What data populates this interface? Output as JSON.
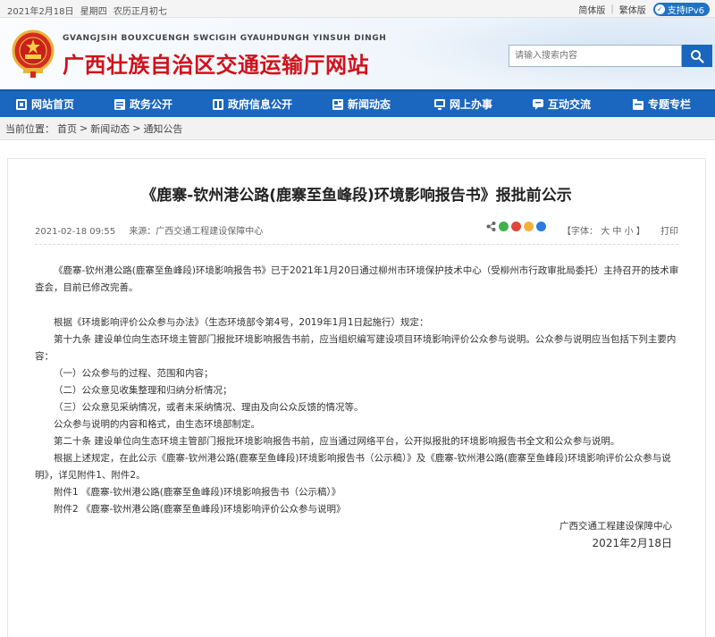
{
  "topbar": {
    "date": "2021年2月18日",
    "weekday": "星期四",
    "lunar": "农历正月初七",
    "simplified": "简体版",
    "traditional": "繁体版",
    "ipv6": "支持IPv6"
  },
  "header": {
    "subtitle": "GVANGJSIH BOUXCUENGH SWCIGIH GYAUHDUNGH YINSUH DINGH",
    "title": "广西壮族自治区交通运输厅网站",
    "search_placeholder": "请输入搜索内容"
  },
  "nav": [
    {
      "label": "网站首页",
      "icon": "home-icon"
    },
    {
      "label": "政务公开",
      "icon": "document-icon"
    },
    {
      "label": "政府信息公开",
      "icon": "info-icon"
    },
    {
      "label": "新闻动态",
      "icon": "news-icon"
    },
    {
      "label": "网上办事",
      "icon": "monitor-icon"
    },
    {
      "label": "互动交流",
      "icon": "chat-icon"
    },
    {
      "label": "专题专栏",
      "icon": "folder-icon"
    }
  ],
  "breadcrumb": {
    "prefix": "当前位置：",
    "items": [
      "首页",
      "新闻动态",
      "通知公告"
    ],
    "sep": ">"
  },
  "article": {
    "title": "《鹿寨-钦州港公路(鹿寨至鱼峰段)环境影响报告书》报批前公示",
    "time": "2021-02-18 09:55",
    "source": "来源：广西交通工程建设保障中心",
    "font_label": "【字体：",
    "font_big": "大",
    "font_mid": "中",
    "font_small": "小",
    "font_end": "】",
    "print": "打印",
    "paragraphs": {
      "p1": "《鹿寨-钦州港公路(鹿寨至鱼峰段)环境影响报告书》已于2021年1月20日通过柳州市环境保护技术中心（受柳州市行政审批局委托）主持召开的技术审查会，目前已修改完善。",
      "p2": "根据《环境影响评价公众参与办法》（生态环境部令第4号，2019年1月1日起施行）规定：",
      "p3": "第十九条 建设单位向生态环境主管部门报批环境影响报告书前，应当组织编写建设项目环境影响评价公众参与说明。公众参与说明应当包括下列主要内容：",
      "p4": "（一）公众参与的过程、范围和内容；",
      "p5": "（二）公众意见收集整理和归纳分析情况；",
      "p6": "（三）公众意见采纳情况，或者未采纳情况、理由及向公众反馈的情况等。",
      "p7": "公众参与说明的内容和格式，由生态环境部制定。",
      "p8": "第二十条 建设单位向生态环境主管部门报批环境影响报告书前，应当通过网络平台，公开拟报批的环境影响报告书全文和公众参与说明。",
      "p9": "根据上述规定，在此公示《鹿寨-钦州港公路(鹿寨至鱼峰段)环境影响报告书（公示稿）》及《鹿寨-钦州港公路(鹿寨至鱼峰段)环境影响评价公众参与说明》，详见附件1、附件2。",
      "p10": "附件1 《鹿寨-钦州港公路(鹿寨至鱼峰段)环境影响报告书（公示稿）》",
      "p11": "附件2 《鹿寨-钦州港公路(鹿寨至鱼峰段)环境影响评价公众参与说明》"
    },
    "signature": "广西交通工程建设保障中心",
    "sign_date": "2021年2月18日"
  },
  "colors": {
    "brand_blue": "#1b66be",
    "title_red": "#d1111b"
  }
}
